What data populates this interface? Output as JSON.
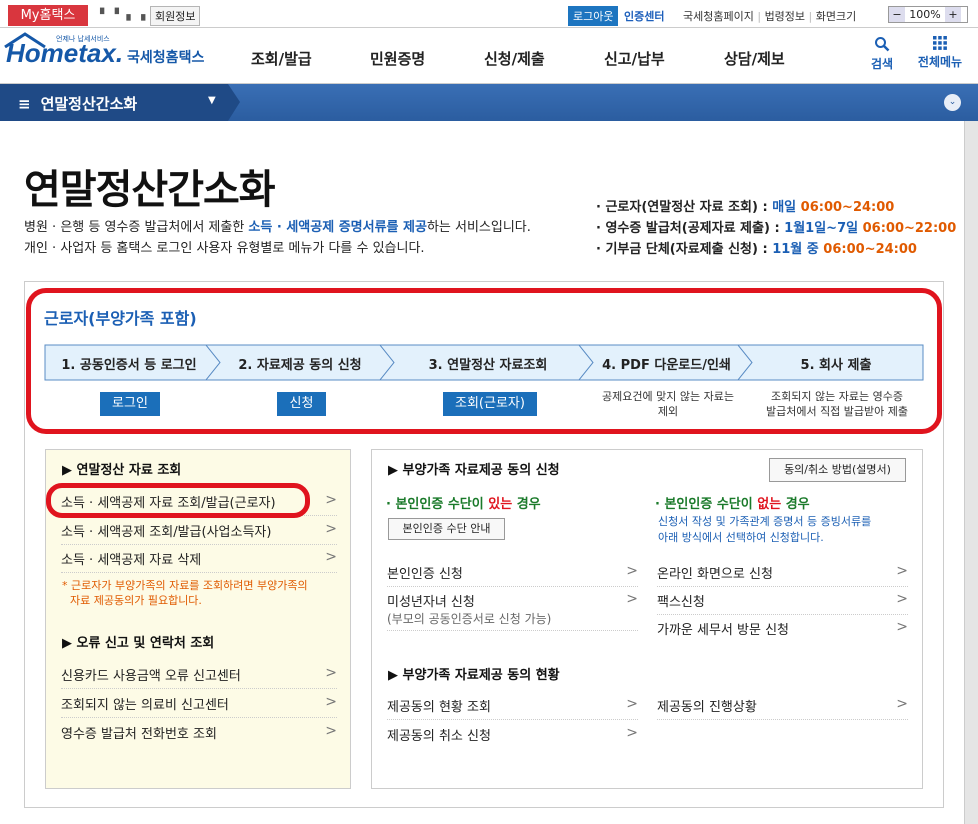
{
  "util": {
    "my_home": "My홈택스",
    "member_info": "회원정보",
    "logout": "로그아웃",
    "cert_center": "인증센터",
    "links": [
      "국세청홈페이지",
      "법령정보",
      "화면크기"
    ],
    "zoom_minus": "−",
    "zoom_value": "100%",
    "zoom_plus": "+"
  },
  "header": {
    "logo_text": "Hometax.",
    "logo_sub": "국세청홈택스",
    "logo_tag": "언제나 납세서비스",
    "nav": [
      "조회/발급",
      "민원증명",
      "신청/제출",
      "신고/납부",
      "상담/제보"
    ],
    "search_label": "검색",
    "allmenu_label": "전체메뉴"
  },
  "bluebar": {
    "title": "연말정산간소화",
    "menu_glyph": "≡",
    "caret": "▼",
    "circle": "⌄"
  },
  "page": {
    "title": "연말정산간소화",
    "desc1_a": "병원 · 은행 등 영수증 발급처에서 제출한 ",
    "desc1_b": "소득 · 세액공제 증명서류를 제공",
    "desc1_c": "하는 서비스입니다.",
    "desc2": "개인 · 사업자 등 홈택스 로그인 사용자 유형별로 메뉴가 다를 수 있습니다."
  },
  "schedule": [
    {
      "label": "· 근로자(연말정산 자료 조회) : ",
      "period": "매일 ",
      "time": "06:00~24:00"
    },
    {
      "label": "· 영수증 발급처(공제자료 제출) : ",
      "period": "1월1일~7일 ",
      "time": "06:00~22:00"
    },
    {
      "label": "· 기부금 단체(자료제출 신청) : ",
      "period": "11월 중 ",
      "time": "06:00~24:00"
    }
  ],
  "worker": {
    "title": "근로자(부양가족 포함)",
    "steps": [
      "1. 공동인증서 등 로그인",
      "2. 자료제공 동의 신청",
      "3. 연말정산 자료조회",
      "4. PDF 다운로드/인쇄",
      "5. 회사 제출"
    ],
    "btn_login": "로그인",
    "btn_apply": "신청",
    "btn_inquiry": "조회(근로자)",
    "note4": [
      "공제요건에 맞지 않는 자료는",
      "제외"
    ],
    "note5": [
      "조회되지 않는 자료는 영수증",
      "발급처에서 직접 발급받아 제출"
    ]
  },
  "left": {
    "section1": "연말정산 자료 조회",
    "items1": [
      "소득 · 세액공제 자료 조회/발급(근로자)",
      "소득 · 세액공제 조회/발급(사업소득자)",
      "소득 · 세액공제 자료 삭제"
    ],
    "warn": [
      "* 근로자가 부양가족의 자료를 조회하려면 부양가족의",
      "자료 제공동의가 필요합니다."
    ],
    "section2": "오류 신고 및 연락처 조회",
    "items2": [
      "신용카드 사용금액 오류 신고센터",
      "조회되지 않는 의료비 신고센터",
      "영수증 발급처 전화번호 조회"
    ]
  },
  "right": {
    "section1": "부양가족 자료제공 동의 신청",
    "method_btn": "동의/취소 방법(설명서)",
    "has_title_a": "· 본인인증 수단이 ",
    "has_title_b": "있는",
    "has_title_c": " 경우",
    "guide_btn": "본인인증 수단 안내",
    "no_title_a": "· 본인인증 수단이 ",
    "no_title_b": "없는",
    "no_title_c": " 경우",
    "no_desc": [
      "신청서 작성 및 가족관계 증명서 등 증빙서류를",
      "아래 방식에서 선택하여 신청합니다."
    ],
    "left_items": [
      "본인인증 신청",
      "미성년자녀 신청"
    ],
    "minor_sub": "(부모의 공동인증서로 신청 가능)",
    "right_items": [
      "온라인 화면으로 신청",
      "팩스신청",
      "가까운 세무서 방문 신청"
    ],
    "section2": "부양가족 자료제공 동의 현황",
    "status_left": [
      "제공동의 현황 조회",
      "제공동의 취소 신청"
    ],
    "status_right": [
      "제공동의 진행상황"
    ]
  },
  "colors": {
    "accent": "#1b5fb4",
    "highlight": "#e0141e",
    "time": "#e05a00",
    "bar": "#2b5da0"
  }
}
